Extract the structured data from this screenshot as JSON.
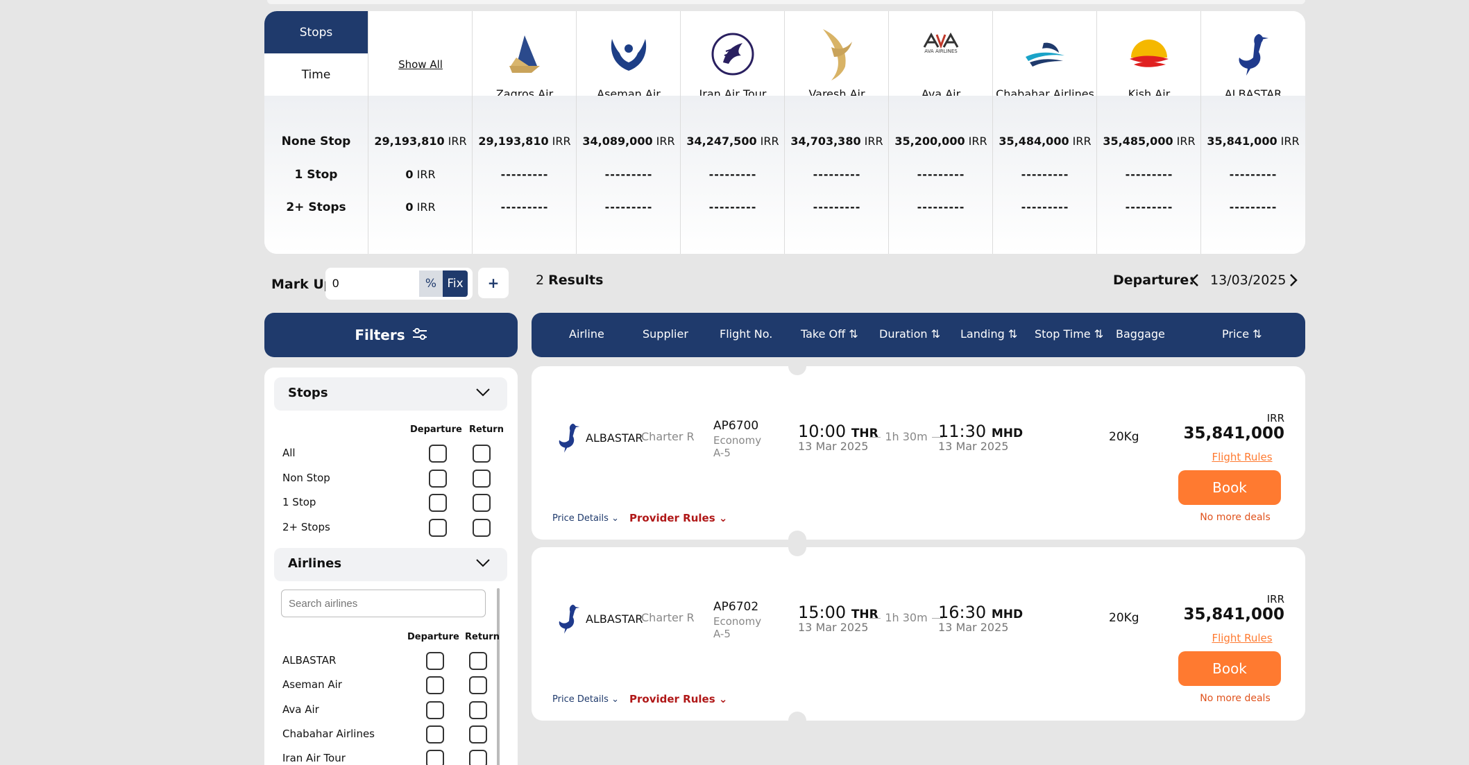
{
  "matrix": {
    "tabs": [
      "Stops",
      "Time"
    ],
    "show_all": "Show All",
    "row_labels": [
      "None Stop",
      "1 Stop",
      "2+ Stops"
    ],
    "columns": [
      {
        "name": "",
        "icon": "",
        "none_stop": "29,193,810",
        "one_stop": "0",
        "two_plus": "0"
      },
      {
        "name": "Zagros Air",
        "icon": "zagros-air-logo-icon",
        "none_stop": "29,193,810",
        "one_stop": "---------",
        "two_plus": "---------"
      },
      {
        "name": "Aseman Air",
        "icon": "aseman-air-logo-icon",
        "none_stop": "34,089,000",
        "one_stop": "---------",
        "two_plus": "---------"
      },
      {
        "name": "Iran Air Tour",
        "icon": "iran-air-tour-logo-icon",
        "none_stop": "34,247,500",
        "one_stop": "---------",
        "two_plus": "---------"
      },
      {
        "name": "Varesh Air",
        "icon": "varesh-air-logo-icon",
        "none_stop": "34,703,380",
        "one_stop": "---------",
        "two_plus": "---------"
      },
      {
        "name": "Ava Air",
        "icon": "ava-air-logo-icon",
        "logo_text": "AVA AIRLINES",
        "none_stop": "35,200,000",
        "one_stop": "---------",
        "two_plus": "---------"
      },
      {
        "name": "Chabahar Airlines",
        "icon": "chabahar-airlines-logo-icon",
        "none_stop": "35,484,000",
        "one_stop": "---------",
        "two_plus": "---------"
      },
      {
        "name": "Kish Air",
        "icon": "kish-air-logo-icon",
        "none_stop": "35,485,000",
        "one_stop": "---------",
        "two_plus": "---------"
      },
      {
        "name": "ALBASTAR",
        "icon": "albastar-logo-icon",
        "none_stop": "35,841,000",
        "one_stop": "---------",
        "two_plus": "---------"
      }
    ],
    "currency": "IRR"
  },
  "markup": {
    "label": "Mark Up",
    "value": "0",
    "pct": "%",
    "fix": "Fix",
    "add": "+"
  },
  "results": {
    "count": "2",
    "label": "Results"
  },
  "departure": {
    "label": "Departure:",
    "date": "13/03/2025"
  },
  "filters": {
    "title": "Filters",
    "stops": {
      "title": "Stops",
      "col_departure": "Departure",
      "col_return": "Return",
      "options": [
        "All",
        "Non Stop",
        "1 Stop",
        "2+ Stops"
      ]
    },
    "airlines": {
      "title": "Airlines",
      "search_placeholder": "Search airlines",
      "col_departure": "Departure",
      "col_return": "Return",
      "options": [
        "ALBASTAR",
        "Aseman Air",
        "Ava Air",
        "Chabahar Airlines",
        "Iran Air Tour"
      ]
    }
  },
  "columns": [
    "Airline",
    "Supplier",
    "Flight No.",
    "Take Off",
    "Duration",
    "Landing",
    "Stop Time",
    "Baggage",
    "Price"
  ],
  "flights": [
    {
      "airline": "ALBASTAR",
      "supplier": "Charter R",
      "flight_no": "AP6700",
      "cabin": "Economy",
      "fare_class": "A-5",
      "takeoff_time": "10:00",
      "takeoff_airport": "THR",
      "takeoff_date": "13 Mar 2025",
      "duration": "1h 30m",
      "landing_time": "11:30",
      "landing_airport": "MHD",
      "landing_date": "13 Mar 2025",
      "baggage": "20Kg",
      "currency": "IRR",
      "price": "35,841,000",
      "flight_rules": "Flight Rules",
      "book": "Book",
      "no_more_deals": "No more deals",
      "price_details": "Price Details",
      "provider_rules": "Provider Rules"
    },
    {
      "airline": "ALBASTAR",
      "supplier": "Charter R",
      "flight_no": "AP6702",
      "cabin": "Economy",
      "fare_class": "A-5",
      "takeoff_time": "15:00",
      "takeoff_airport": "THR",
      "takeoff_date": "13 Mar 2025",
      "duration": "1h 30m",
      "landing_time": "16:30",
      "landing_airport": "MHD",
      "landing_date": "13 Mar 2025",
      "baggage": "20Kg",
      "currency": "IRR",
      "price": "35,841,000",
      "flight_rules": "Flight Rules",
      "book": "Book",
      "no_more_deals": "No more deals",
      "price_details": "Price Details",
      "provider_rules": "Provider Rules"
    }
  ],
  "colors": {
    "navy": "#1f3a6c",
    "orange": "#ff7a30",
    "provider_red": "#b01818"
  }
}
